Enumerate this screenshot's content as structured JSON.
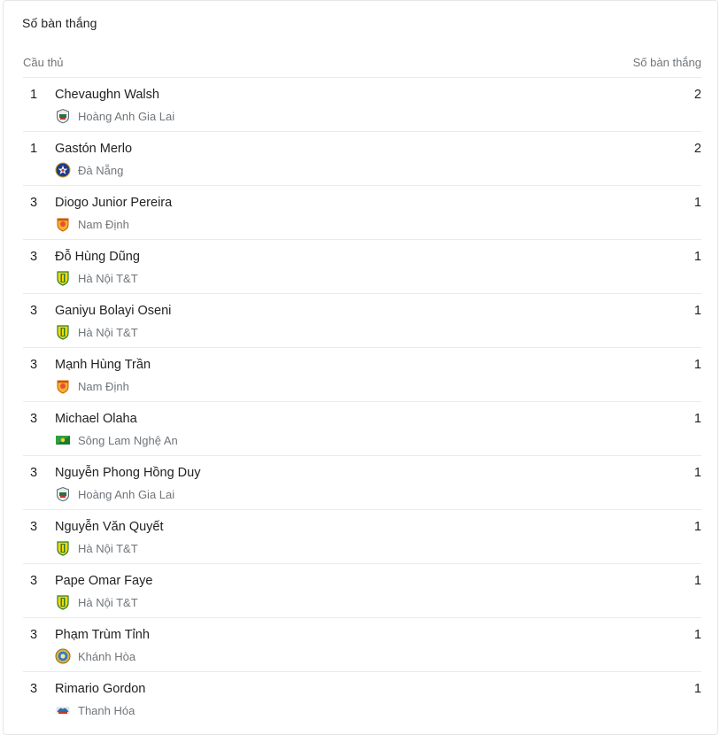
{
  "title": "Số bàn thắng",
  "columns": {
    "player": "Cầu thủ",
    "goals": "Số bàn thắng"
  },
  "rows": [
    {
      "rank": "1",
      "name": "Chevaughn Walsh",
      "team": "Hoàng Anh Gia Lai",
      "logo": "hagl-logo-icon",
      "goals": "2"
    },
    {
      "rank": "1",
      "name": "Gastón Merlo",
      "team": "Đà Nẵng",
      "logo": "da-nang-logo-icon",
      "goals": "2"
    },
    {
      "rank": "3",
      "name": "Diogo Junior Pereira",
      "team": "Nam Định",
      "logo": "nam-dinh-logo-icon",
      "goals": "1"
    },
    {
      "rank": "3",
      "name": "Đỗ Hùng Dũng",
      "team": "Hà Nội T&T",
      "logo": "ha-noi-logo-icon",
      "goals": "1"
    },
    {
      "rank": "3",
      "name": "Ganiyu Bolayi Oseni",
      "team": "Hà Nội T&T",
      "logo": "ha-noi-logo-icon",
      "goals": "1"
    },
    {
      "rank": "3",
      "name": "Mạnh Hùng Trần",
      "team": "Nam Định",
      "logo": "nam-dinh-logo-icon",
      "goals": "1"
    },
    {
      "rank": "3",
      "name": "Michael Olaha",
      "team": "Sông Lam Nghệ An",
      "logo": "slna-logo-icon",
      "goals": "1"
    },
    {
      "rank": "3",
      "name": "Nguyễn Phong Hồng Duy",
      "team": "Hoàng Anh Gia Lai",
      "logo": "hagl-logo-icon",
      "goals": "1"
    },
    {
      "rank": "3",
      "name": "Nguyễn Văn Quyết",
      "team": "Hà Nội T&T",
      "logo": "ha-noi-logo-icon",
      "goals": "1"
    },
    {
      "rank": "3",
      "name": "Pape Omar Faye",
      "team": "Hà Nội T&T",
      "logo": "ha-noi-logo-icon",
      "goals": "1"
    },
    {
      "rank": "3",
      "name": "Phạm Trùm Tỉnh",
      "team": "Khánh Hòa",
      "logo": "khanh-hoa-logo-icon",
      "goals": "1"
    },
    {
      "rank": "3",
      "name": "Rimario Gordon",
      "team": "Thanh Hóa",
      "logo": "thanh-hoa-logo-icon",
      "goals": "1"
    }
  ]
}
